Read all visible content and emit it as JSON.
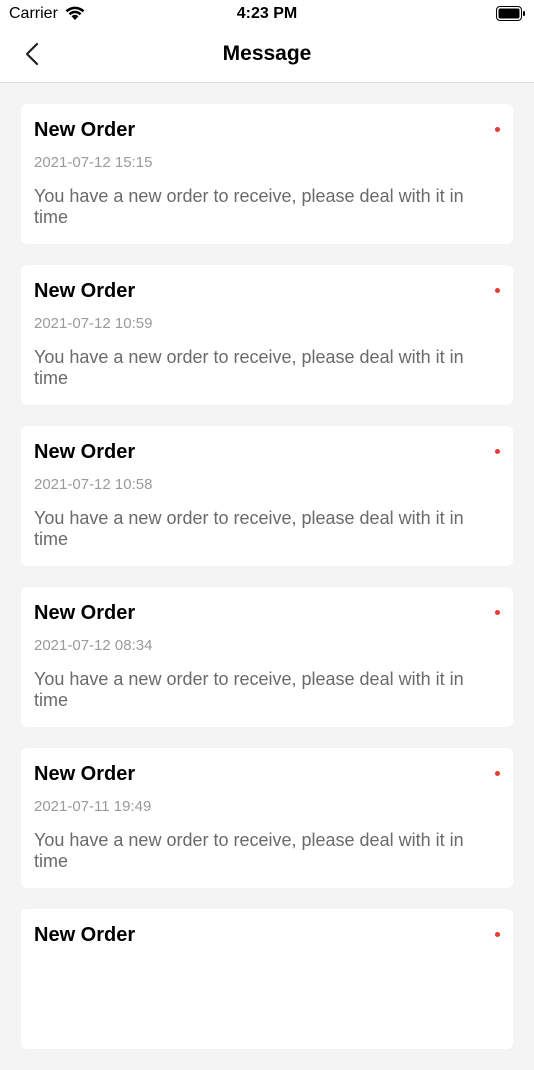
{
  "status_bar": {
    "carrier": "Carrier",
    "time": "4:23 PM"
  },
  "nav": {
    "title": "Message",
    "back_icon": "chevron-left-icon"
  },
  "colors": {
    "unread_dot": "#e83a30",
    "background": "#f4f4f4"
  },
  "messages": [
    {
      "title": "New Order",
      "time": "2021-07-12 15:15",
      "body": "You have a new order to receive, please deal with it in time",
      "unread": true
    },
    {
      "title": "New Order",
      "time": "2021-07-12 10:59",
      "body": "You have a new order to receive, please deal with it in time",
      "unread": true
    },
    {
      "title": "New Order",
      "time": "2021-07-12 10:58",
      "body": "You have a new order to receive, please deal with it in time",
      "unread": true
    },
    {
      "title": "New Order",
      "time": "2021-07-12 08:34",
      "body": "You have a new order to receive, please deal with it in time",
      "unread": true
    },
    {
      "title": "New Order",
      "time": "2021-07-11 19:49",
      "body": "You have a new order to receive, please deal with it in time",
      "unread": true
    },
    {
      "title": "New Order",
      "time": "",
      "body": "",
      "unread": true
    }
  ]
}
